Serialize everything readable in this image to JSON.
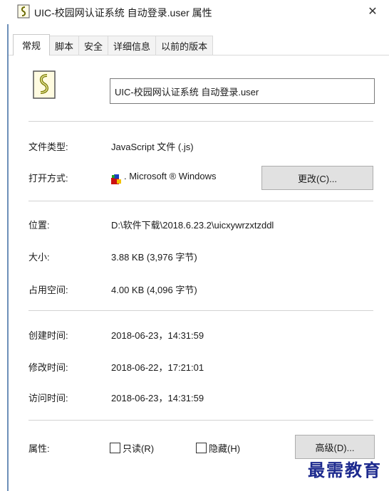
{
  "window": {
    "title": "UIC-校园网认证系统 自动登录.user 属性",
    "close_glyph": "✕"
  },
  "tabs": [
    {
      "label": "常规",
      "active": true
    },
    {
      "label": "脚本",
      "active": false
    },
    {
      "label": "安全",
      "active": false
    },
    {
      "label": "详细信息",
      "active": false
    },
    {
      "label": "以前的版本",
      "active": false
    }
  ],
  "general": {
    "file_name": "UIC-校园网认证系统 自动登录.user",
    "file_type_label": "文件类型:",
    "file_type_value": "JavaScript 文件 (.js)",
    "opens_with_label": "打开方式:",
    "opens_with_value": ". Microsoft ® Windows",
    "change_button": "更改(C)...",
    "location_label": "位置:",
    "location_value": "D:\\软件下载\\2018.6.23.2\\uicxywrzxtzddl",
    "size_label": "大小:",
    "size_value": "3.88 KB (3,976 字节)",
    "size_on_disk_label": "占用空间:",
    "size_on_disk_value": "4.00 KB (4,096 字节)",
    "created_label": "创建时间:",
    "created_value": "2018-06-23，14:31:59",
    "modified_label": "修改时间:",
    "modified_value": "2018-06-22，17:21:01",
    "accessed_label": "访问时间:",
    "accessed_value": "2018-06-23，14:31:59",
    "attributes_label": "属性:",
    "readonly_label": "只读(R)",
    "readonly_checked": false,
    "hidden_label": "隐藏(H)",
    "hidden_checked": false,
    "advanced_button": "高级(D)..."
  },
  "watermark": "最需教育",
  "colors": {
    "window_border": "#6d8fb8",
    "button_bg": "#e1e1e1",
    "watermark": "#1d2a8e"
  }
}
